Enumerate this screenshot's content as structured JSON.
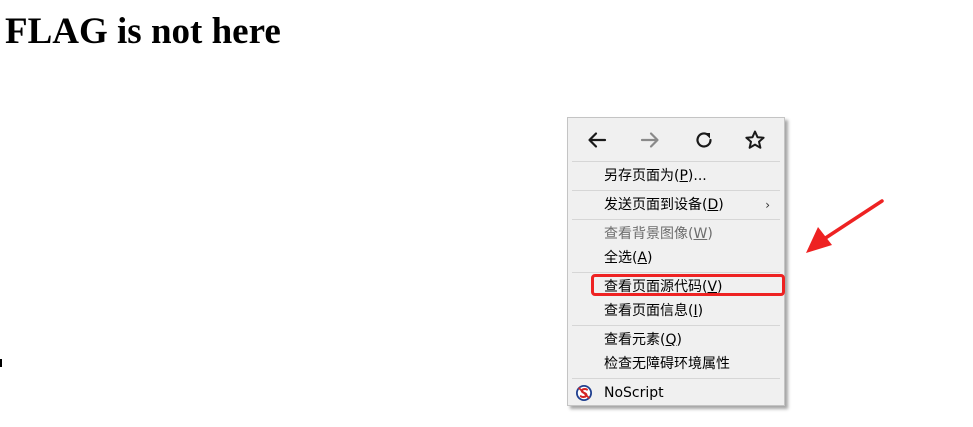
{
  "page": {
    "heading": "FLAG is not here"
  },
  "nav": {
    "back_icon": "arrow-left-icon",
    "forward_icon": "arrow-right-icon",
    "reload_icon": "reload-icon",
    "bookmark_icon": "star-icon"
  },
  "menu": {
    "items": [
      {
        "pre": "另存页面为(",
        "key": "P",
        "post": ")..."
      },
      {
        "pre": "发送页面到设备(",
        "key": "D",
        "post": ")",
        "arrow": "›"
      },
      {
        "pre": "查看背景图像(",
        "key": "W",
        "post": ")"
      },
      {
        "pre": "全选(",
        "key": "A",
        "post": ")"
      },
      {
        "pre": "查看页面源代码(",
        "key": "V",
        "post": ")"
      },
      {
        "pre": "查看页面信息(",
        "key": "I",
        "post": ")"
      },
      {
        "pre": "查看元素(",
        "key": "Q",
        "post": ")"
      },
      {
        "label": "检查无障碍环境属性"
      },
      {
        "label": "NoScript",
        "icon": "noscript-icon"
      }
    ]
  },
  "colors": {
    "highlight": "#ee2222",
    "menu_bg": "#f0f0f0",
    "disabled_text": "#6d6d6d"
  }
}
